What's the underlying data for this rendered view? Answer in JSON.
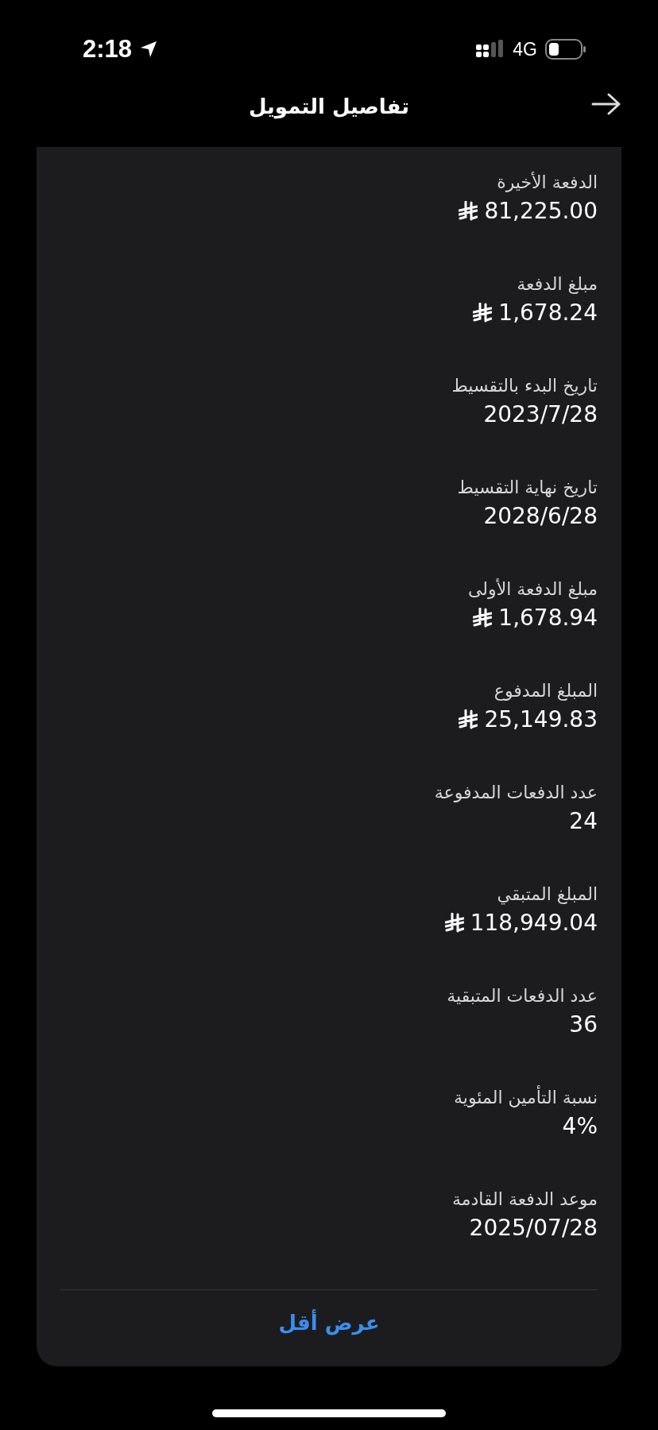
{
  "status_bar": {
    "time": "2:18",
    "network": "4G"
  },
  "header": {
    "title": "تفاصيل التمويل"
  },
  "details": [
    {
      "label": "الدفعة الأخيرة",
      "value": "81,225.00",
      "kind": "amount"
    },
    {
      "label": "مبلغ الدفعة",
      "value": "1,678.24",
      "kind": "amount"
    },
    {
      "label": "تاريخ البدء بالتقسيط",
      "value": "2023/7/28",
      "kind": "plain"
    },
    {
      "label": "تاريخ نهاية التقسيط",
      "value": "2028/6/28",
      "kind": "plain"
    },
    {
      "label": "مبلغ الدفعة الأولى",
      "value": "1,678.94",
      "kind": "amount"
    },
    {
      "label": "المبلغ المدفوع",
      "value": "25,149.83",
      "kind": "amount"
    },
    {
      "label": "عدد الدفعات المدفوعة",
      "value": "24",
      "kind": "plain"
    },
    {
      "label": "المبلغ المتبقي",
      "value": "118,949.04",
      "kind": "amount"
    },
    {
      "label": "عدد الدفعات المتبقية",
      "value": "36",
      "kind": "plain"
    },
    {
      "label": "نسبة التأمين المئوية",
      "value": "4%",
      "kind": "plain"
    },
    {
      "label": "موعد الدفعة القادمة",
      "value": "2025/07/28",
      "kind": "plain"
    }
  ],
  "show_less_button": "عرض أقل"
}
